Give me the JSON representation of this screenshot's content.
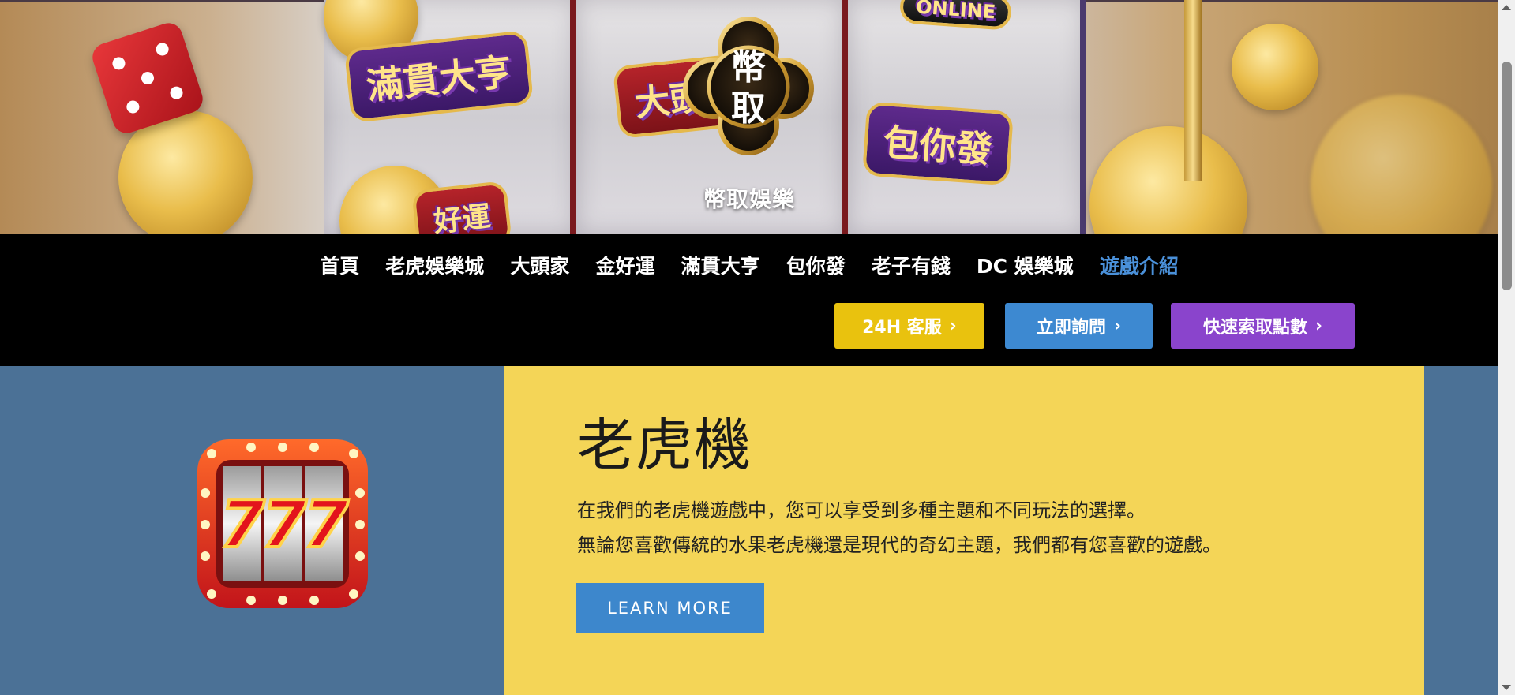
{
  "hero": {
    "logo_text": "幣取",
    "site_title": "幣取娛樂",
    "decor_badges": [
      "滿貫大亨",
      "大頭家",
      "包你發",
      "好運",
      "ONLINE"
    ]
  },
  "nav": {
    "items": [
      {
        "label": "首頁",
        "active": false
      },
      {
        "label": "老虎娛樂城",
        "active": false
      },
      {
        "label": "大頭家",
        "active": false
      },
      {
        "label": "金好運",
        "active": false
      },
      {
        "label": "滿貫大亨",
        "active": false
      },
      {
        "label": "包你發",
        "active": false
      },
      {
        "label": "老子有錢",
        "active": false
      },
      {
        "label": "DC 娛樂城",
        "active": false
      },
      {
        "label": "遊戲介紹",
        "active": true
      }
    ],
    "cta": {
      "support": "24H 客服",
      "inquire": "立即詢問",
      "points": "快速索取點數"
    }
  },
  "content": {
    "title": "老虎機",
    "desc_line1": "在我們的老虎機遊戲中，您可以享受到多種主題和不同玩法的選擇。",
    "desc_line2": "無論您喜歡傳統的水果老虎機還是現代的奇幻主題，我們都有您喜歡的遊戲。",
    "button": "LEARN MORE",
    "icon_text": "777"
  },
  "colors": {
    "nav_active": "#4a90d9",
    "cta_yellow": "#e9c20e",
    "cta_blue": "#3d89d1",
    "cta_purple": "#8a44cc",
    "content_bg": "#4b7196",
    "card_bg": "#f4d557"
  },
  "icons": [
    "chevron-right-icon",
    "slot-777-icon",
    "logo-icon",
    "scroll-up-icon",
    "scroll-down-icon"
  ]
}
